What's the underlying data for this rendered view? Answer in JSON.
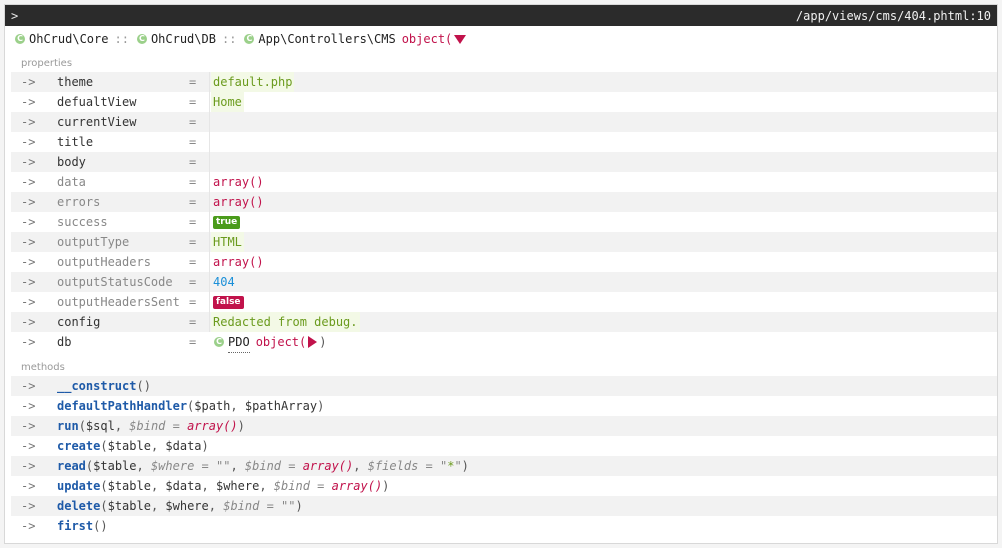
{
  "title_left": ">",
  "title_right": "/app/views/cms/404.phtml:10",
  "class_chain": [
    "OhCrud\\Core",
    "OhCrud\\DB",
    "App\\Controllers\\CMS"
  ],
  "class_sep": "::",
  "object_label": "object(",
  "sections": {
    "properties": "properties",
    "methods": "methods"
  },
  "arrow": "->",
  "eq": "=",
  "properties": [
    {
      "key": "theme",
      "type": "string",
      "value": "default.php",
      "dim": false
    },
    {
      "key": "defualtView",
      "type": "string",
      "value": "Home",
      "dim": false
    },
    {
      "key": "currentView",
      "type": "empty",
      "value": "",
      "dim": false
    },
    {
      "key": "title",
      "type": "empty",
      "value": "",
      "dim": false
    },
    {
      "key": "body",
      "type": "empty",
      "value": "",
      "dim": false
    },
    {
      "key": "data",
      "type": "array",
      "value": "array()",
      "dim": true
    },
    {
      "key": "errors",
      "type": "array",
      "value": "array()",
      "dim": true
    },
    {
      "key": "success",
      "type": "true",
      "value": "true",
      "dim": true
    },
    {
      "key": "outputType",
      "type": "string",
      "value": "HTML",
      "dim": true
    },
    {
      "key": "outputHeaders",
      "type": "array",
      "value": "array()",
      "dim": true
    },
    {
      "key": "outputStatusCode",
      "type": "number",
      "value": "404",
      "dim": true
    },
    {
      "key": "outputHeadersSent",
      "type": "false",
      "value": "false",
      "dim": true
    },
    {
      "key": "config",
      "type": "string",
      "value": "Redacted from debug.",
      "dim": false
    },
    {
      "key": "db",
      "type": "object",
      "value": "PDO",
      "object_label": "object(",
      "close": ")",
      "dim": false
    }
  ],
  "methods": [
    {
      "name": "__construct",
      "args": "()"
    },
    {
      "name": "defaultPathHandler",
      "args": "($path, $pathArray)"
    },
    {
      "name": "run",
      "args": "($sql, $bind = array())"
    },
    {
      "name": "create",
      "args": "($table, $data)"
    },
    {
      "name": "read",
      "args": "($table, $where = \"\", $bind = array(), $fields = \"*\")"
    },
    {
      "name": "update",
      "args": "($table, $data, $where, $bind = array())"
    },
    {
      "name": "delete",
      "args": "($table, $where, $bind = \"\")"
    },
    {
      "name": "first",
      "args": "()"
    }
  ],
  "colors": {
    "string": "#6b9b1e",
    "array": "#c1124b",
    "number": "#1a8fd8",
    "method": "#1e5aa8",
    "titlebar": "#2b2b2b"
  }
}
